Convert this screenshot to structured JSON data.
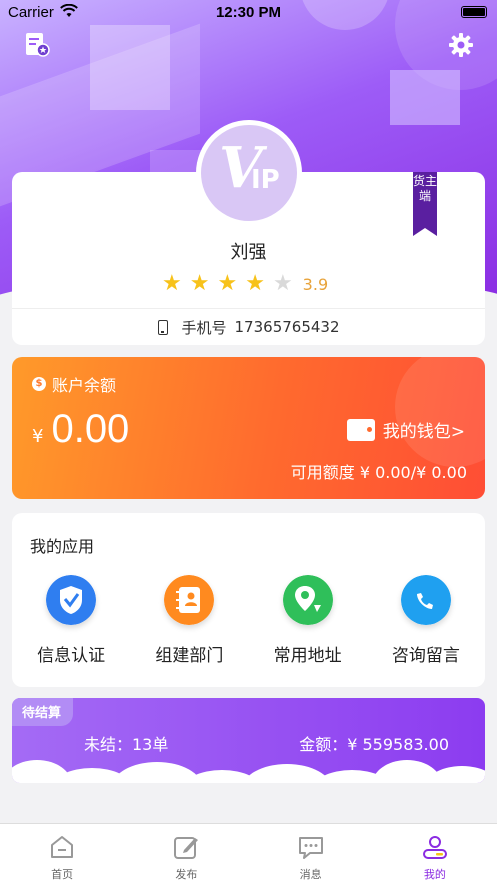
{
  "status_bar": {
    "carrier": "Carrier",
    "time": "12:30 PM"
  },
  "profile": {
    "avatar_text_v": "V",
    "avatar_text_ip": "IP",
    "role": "货主端",
    "name": "刘强",
    "rating": {
      "stars_filled": 4,
      "stars_total": 5,
      "value": "3.9"
    },
    "phone_label": "手机号",
    "phone_number": "17365765432"
  },
  "balance": {
    "title": "账户余额",
    "currency": "¥",
    "amount": "0.00",
    "wallet_link": "我的钱包>",
    "credit": "可用额度 ¥ 0.00/¥ 0.00"
  },
  "apps": {
    "title": "我的应用",
    "items": [
      {
        "label": "信息认证",
        "icon": "shield-check-icon",
        "color": "#2f7ef0"
      },
      {
        "label": "组建部门",
        "icon": "contacts-book-icon",
        "color": "#ff8a1f"
      },
      {
        "label": "常用地址",
        "icon": "map-pin-icon",
        "color": "#2fbf5a"
      },
      {
        "label": "咨询留言",
        "icon": "chat-bubble-icon",
        "color": "#1fa0f0"
      }
    ]
  },
  "settlement": {
    "tag": "待结算",
    "unsettled": "未结：13单",
    "amount": "金额：¥ 559583.00"
  },
  "tabs": [
    {
      "label": "首页",
      "icon": "home-icon",
      "active": false
    },
    {
      "label": "发布",
      "icon": "edit-icon",
      "active": false
    },
    {
      "label": "消息",
      "icon": "message-icon",
      "active": false
    },
    {
      "label": "我的",
      "icon": "user-icon",
      "active": true
    }
  ],
  "colors": {
    "brand_purple": "#8a2be2",
    "orange": "#ff6a2e",
    "star": "#f7c21a",
    "rating_text": "#e8a33a"
  }
}
